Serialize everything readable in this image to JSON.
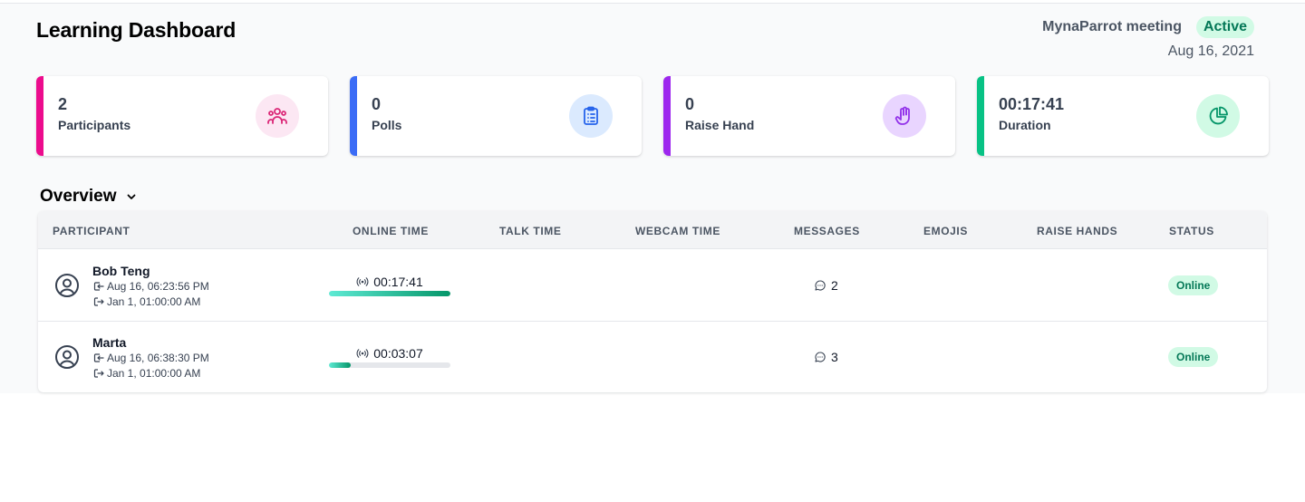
{
  "header": {
    "title": "Learning Dashboard",
    "meeting_name": "MynaParrot meeting",
    "status": "Active",
    "date": "Aug 16, 2021"
  },
  "cards": [
    {
      "value": "2",
      "label": "Participants",
      "color": "#ec0c8d",
      "icon": "users-icon"
    },
    {
      "value": "0",
      "label": "Polls",
      "color": "#3b6cf6",
      "icon": "clipboard-list-icon"
    },
    {
      "value": "0",
      "label": "Raise Hand",
      "color": "#9d27ee",
      "icon": "hand-icon"
    },
    {
      "value": "00:17:41",
      "label": "Duration",
      "color": "#08c285",
      "icon": "pie-chart-icon"
    }
  ],
  "overview": {
    "title": "Overview"
  },
  "table": {
    "headers": [
      "PARTICIPANT",
      "ONLINE TIME",
      "TALK TIME",
      "WEBCAM TIME",
      "MESSAGES",
      "EMOJIS",
      "RAISE HANDS",
      "STATUS"
    ],
    "rows": [
      {
        "name": "Bob Teng",
        "joined": "Aug 16, 06:23:56 PM",
        "left": "Jan 1, 01:00:00 AM",
        "online_time": "00:17:41",
        "online_progress": 1.0,
        "messages": "2",
        "status": "Online"
      },
      {
        "name": "Marta",
        "joined": "Aug 16, 06:38:30 PM",
        "left": "Jan 1, 01:00:00 AM",
        "online_time": "00:03:07",
        "online_progress": 0.18,
        "messages": "3",
        "status": "Online"
      }
    ]
  }
}
